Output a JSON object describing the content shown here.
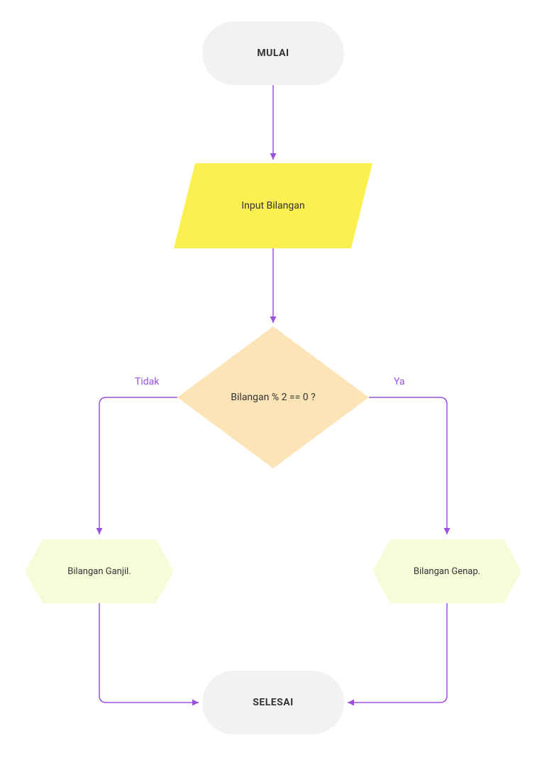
{
  "flowchart": {
    "start": {
      "label": "MULAI"
    },
    "input": {
      "label": "Input Bilangan"
    },
    "decision": {
      "label": "Bilangan % 2 == 0 ?"
    },
    "branch_no": {
      "label": "Tidak"
    },
    "branch_yes": {
      "label": "Ya"
    },
    "output_odd": {
      "label": "Bilangan Ganjil."
    },
    "output_even": {
      "label": "Bilangan Genap."
    },
    "end": {
      "label": "SELESAI"
    }
  },
  "colors": {
    "terminator_fill": "#F2F2F2",
    "input_fill": "#FCF050",
    "decision_fill": "#FCE4B6",
    "output_fill": "#F8FBD9",
    "arrow": "#9B51E0",
    "edge_text": "#9B51E0"
  }
}
